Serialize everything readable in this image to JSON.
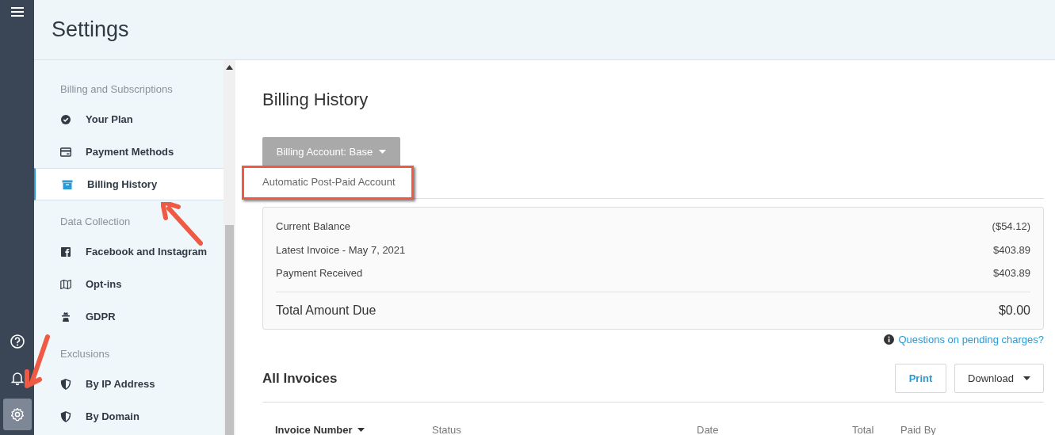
{
  "header": {
    "title": "Settings"
  },
  "nav_rail": {
    "items": [
      {
        "kind": "help",
        "selected": false
      },
      {
        "kind": "bell",
        "selected": false
      },
      {
        "kind": "gear",
        "selected": true
      }
    ]
  },
  "sidebar": {
    "sections": [
      {
        "title": "Billing and Subscriptions",
        "items": [
          {
            "label": "Your Plan",
            "kind": "badge",
            "selected": false
          },
          {
            "label": "Payment Methods",
            "kind": "card",
            "selected": false
          },
          {
            "label": "Billing History",
            "kind": "archive",
            "selected": true
          }
        ]
      },
      {
        "title": "Data Collection",
        "items": [
          {
            "label": "Facebook and Instagram",
            "kind": "facebook",
            "selected": false
          },
          {
            "label": "Opt-ins",
            "kind": "map",
            "selected": false
          },
          {
            "label": "GDPR",
            "kind": "spy",
            "selected": false
          }
        ]
      },
      {
        "title": "Exclusions",
        "items": [
          {
            "label": "By IP Address",
            "kind": "shield",
            "selected": false
          },
          {
            "label": "By Domain",
            "kind": "shield",
            "selected": false
          }
        ]
      }
    ]
  },
  "main": {
    "title": "Billing History",
    "account_dropdown": {
      "label": "Billing Account: Base",
      "disabled": true
    },
    "account_type": "Automatic Post-Paid Account",
    "summary": {
      "rows": [
        {
          "label": "Current Balance",
          "value": "($54.12)"
        },
        {
          "label": "Latest Invoice - May 7, 2021",
          "value": "$403.89"
        },
        {
          "label": "Payment Received",
          "value": "$403.89"
        }
      ],
      "total": {
        "label": "Total Amount Due",
        "value": "$0.00"
      }
    },
    "help_link": "Questions on pending charges?",
    "invoices": {
      "title": "All Invoices",
      "print_button": "Print",
      "download_button": "Download",
      "columns": [
        {
          "label": "Invoice Number",
          "sorted": true
        },
        {
          "label": "Status",
          "sorted": false
        },
        {
          "label": "Date",
          "sorted": false
        },
        {
          "label": "Total",
          "sorted": false
        },
        {
          "label": "Paid By",
          "sorted": false
        }
      ]
    }
  }
}
